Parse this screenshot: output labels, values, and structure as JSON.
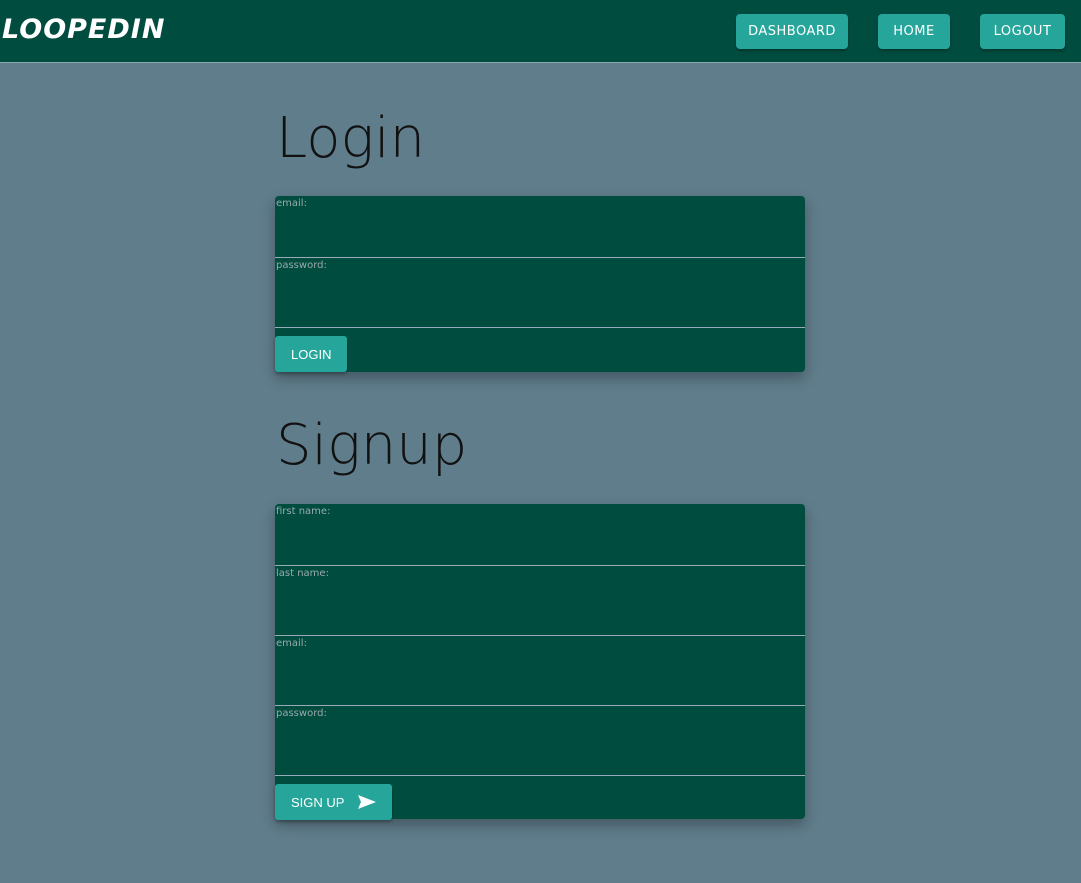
{
  "brand": "LOOPEDIN",
  "nav": {
    "dashboard": "DASHBOARD",
    "home": "HOME",
    "logout": "LOGOUT"
  },
  "login": {
    "title": "Login",
    "email_label": "email:",
    "password_label": "password:",
    "button": "LOGIN"
  },
  "signup": {
    "title": "Signup",
    "first_name_label": "first name:",
    "last_name_label": "last name:",
    "email_label": "email:",
    "password_label": "password:",
    "button": "SIGN UP"
  }
}
